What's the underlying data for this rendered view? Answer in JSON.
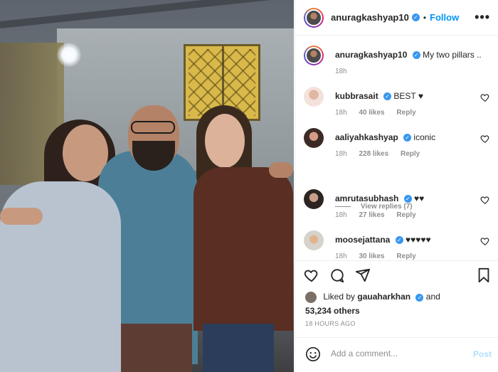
{
  "post": {
    "author": "anuragkashyap10",
    "follow_label": "Follow",
    "separator": "•",
    "more_label": "•••",
    "caption": "My two pillars ..",
    "caption_time": "18h"
  },
  "comments": [
    {
      "user": "kubbrasait",
      "text": "BEST ♥",
      "time": "18h",
      "likes": "40 likes",
      "reply": "Reply"
    },
    {
      "user": "aaliyahkashyap",
      "text": "iconic",
      "time": "18h",
      "likes": "228 likes",
      "reply": "Reply"
    },
    {
      "user": "amrutasubhash",
      "text": "♥♥",
      "time": "18h",
      "likes": "27 likes",
      "reply": "Reply"
    },
    {
      "user": "moosejattana",
      "text": "♥♥♥♥♥",
      "time": "18h",
      "likes": "30 likes",
      "reply": "Reply"
    }
  ],
  "view_replies": "View replies (7)",
  "likes": {
    "prefix": "Liked by",
    "user": "gauaharkhan",
    "suffix": "and",
    "others": "53,234 others"
  },
  "timestamp": "18 HOURS AGO",
  "add_comment": {
    "placeholder": "Add a comment...",
    "post_label": "Post"
  },
  "colors": {
    "link_blue": "#0095f6",
    "verified_blue": "#3897f0",
    "post_disabled": "#b2dffc",
    "muted_text": "#8e8e8e"
  },
  "icons": [
    "verified-badge-icon",
    "more-options-icon",
    "heart-icon",
    "comment-icon",
    "share-icon",
    "bookmark-icon",
    "emoji-icon"
  ]
}
